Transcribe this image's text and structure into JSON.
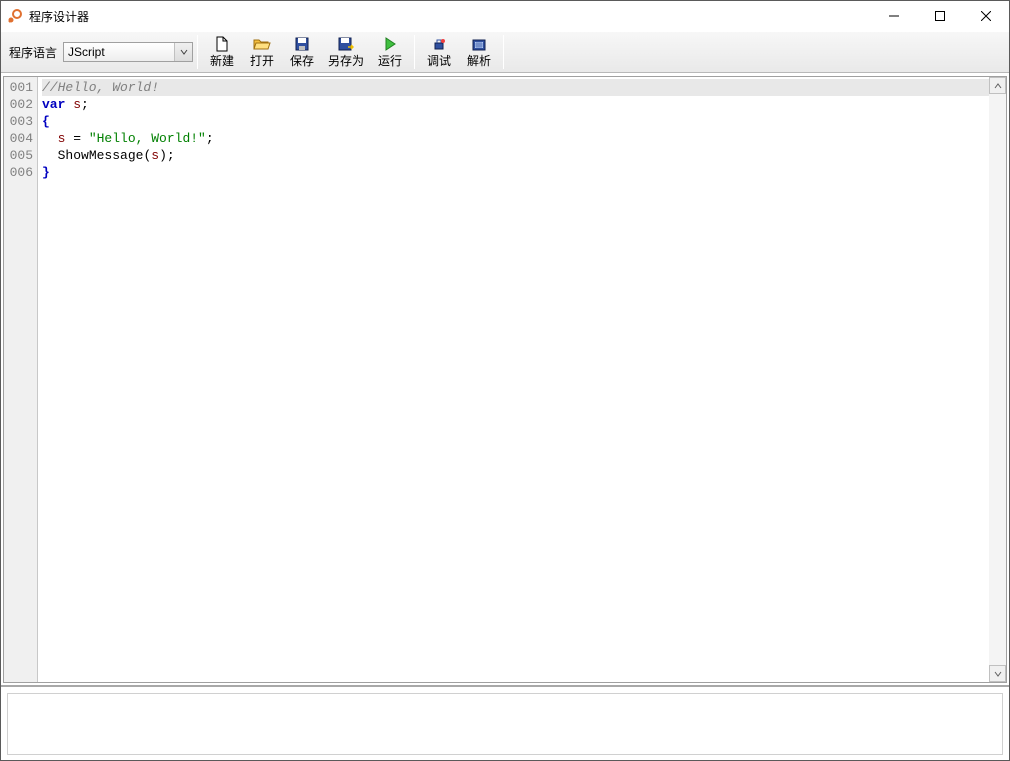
{
  "window": {
    "title": "程序设计器"
  },
  "toolbar": {
    "lang_label": "程序语言",
    "lang_value": "JScript",
    "buttons": {
      "new": "新建",
      "open": "打开",
      "save": "保存",
      "saveas": "另存为",
      "run": "运行",
      "debug": "调试",
      "parse": "解析"
    }
  },
  "editor": {
    "line_numbers": [
      "001",
      "002",
      "003",
      "004",
      "005",
      "006"
    ],
    "lines": [
      {
        "type": "comment",
        "raw": "//Hello, World!"
      },
      {
        "type": "decl",
        "kw": "var",
        "ident": "s",
        "tail": ";"
      },
      {
        "type": "brace",
        "raw": "{"
      },
      {
        "type": "assign",
        "indent": "  ",
        "ident": "s",
        "op": " = ",
        "str": "\"Hello, World!\"",
        "tail": ";"
      },
      {
        "type": "call",
        "indent": "  ",
        "func": "ShowMessage",
        "open": "(",
        "arg": "s",
        "close": ")",
        "tail": ";"
      },
      {
        "type": "brace",
        "raw": "}"
      }
    ]
  },
  "status": {
    "text": ""
  }
}
